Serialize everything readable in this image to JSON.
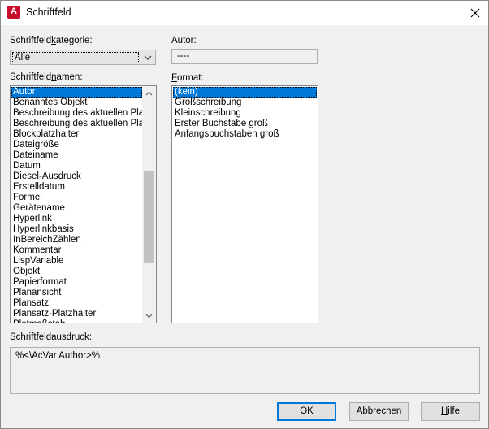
{
  "window": {
    "title": "Schriftfeld",
    "app_icon_letter": "A"
  },
  "category": {
    "label_pre": "Schriftfeld",
    "label_mn": "k",
    "label_post": "ategorie:",
    "selected": "Alle"
  },
  "author": {
    "label": "Autor:",
    "value": "----"
  },
  "names": {
    "label_pre": "Schriftfeld",
    "label_mn": "n",
    "label_post": "amen:",
    "items": [
      "Autor",
      "Benanntes Objekt",
      "Beschreibung des aktuellen Plans",
      "Beschreibung des aktuellen Plans",
      "Blockplatzhalter",
      "Dateigröße",
      "Dateiname",
      "Datum",
      "Diesel-Ausdruck",
      "Erstelldatum",
      "Formel",
      "Gerätename",
      "Hyperlink",
      "Hyperlinkbasis",
      "InBereichZählen",
      "Kommentar",
      "LispVariable",
      "Objekt",
      "Papierformat",
      "Planansicht",
      "Plansatz",
      "Plansatz-Platzhalter",
      "Plotmaßstab"
    ],
    "selected_index": 0
  },
  "format": {
    "label_mn": "F",
    "label_post": "ormat:",
    "items": [
      "(kein)",
      "Großschreibung",
      "Kleinschreibung",
      "Erster Buchstabe groß",
      "Anfangsbuchstaben groß"
    ],
    "selected_index": 0
  },
  "expression": {
    "label": "Schriftfeldausdruck:",
    "value": "%<\\AcVar Author>%"
  },
  "buttons": {
    "ok": "OK",
    "cancel": "Abbrechen",
    "help_mn": "H",
    "help_post": "ilfe"
  }
}
